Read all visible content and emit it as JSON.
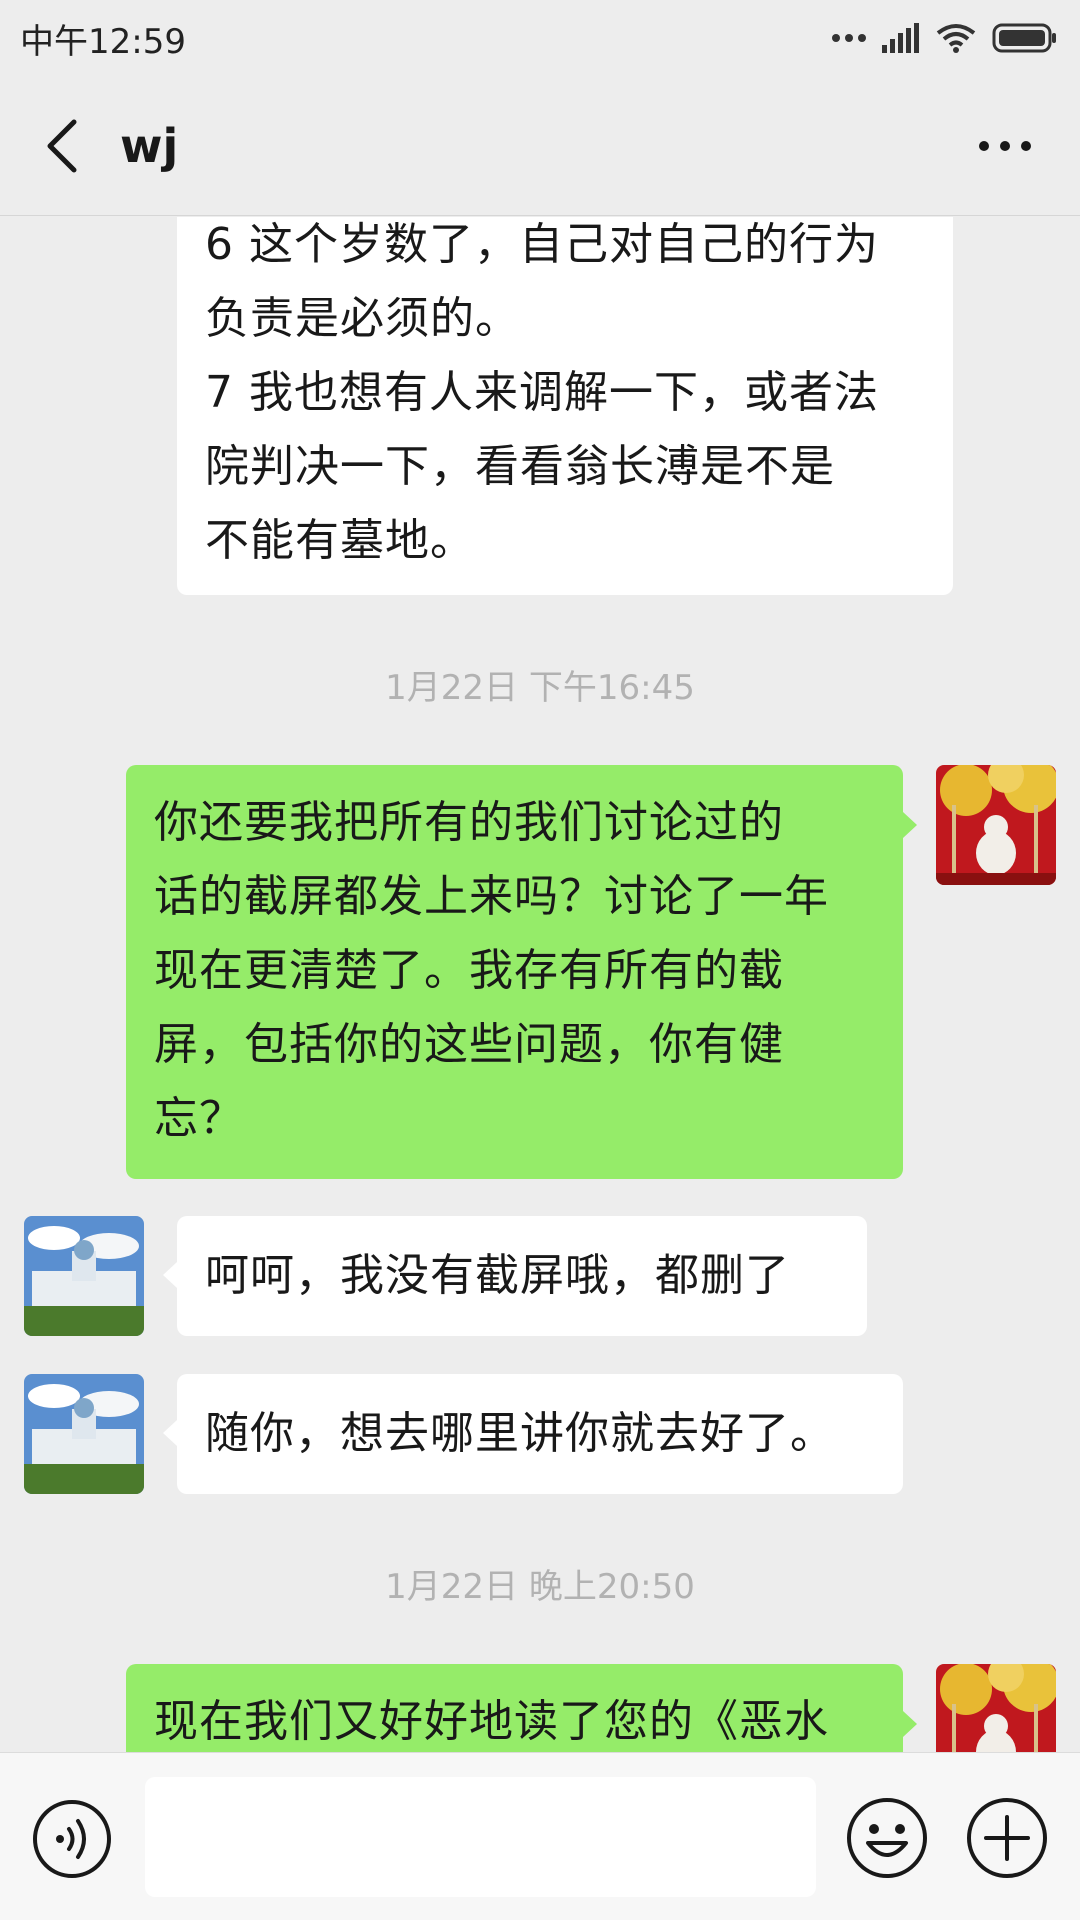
{
  "status_bar": {
    "time": "中午12:59"
  },
  "header": {
    "title": "wj",
    "back_icon": "chevron-left-icon",
    "more_icon": "more-horizontal-icon"
  },
  "messages": [
    {
      "side": "left",
      "text": "6 这个岁数了，自己对自己的行为\n负责是必须的。\n7 我也想有人来调解一下，或者法\n院判决一下，看看翁长溥是不是\n不能有墓地。"
    },
    {
      "timestamp": "1月22日 下午16:45"
    },
    {
      "side": "right",
      "text": "你还要我把所有的我们讨论过的\n话的截屏都发上来吗？讨论了一年\n现在更清楚了。我存有所有的截\n屏，包括你的这些问题，你有健\n忘？"
    },
    {
      "side": "left",
      "text": "呵呵，我没有截屏哦，都删了"
    },
    {
      "side": "left",
      "text": "随你，想去哪里讲你就去好了。"
    },
    {
      "timestamp": "1月22日 晚上20:50"
    },
    {
      "side": "right",
      "text": "现在我们又好好地读了您的《恶水"
    }
  ],
  "input_bar": {
    "placeholder": "",
    "value": ""
  },
  "colors": {
    "background": "#ededed",
    "bubble_self": "#95ec69",
    "bubble_other": "#ffffff",
    "timestamp": "#b2b2b2"
  }
}
